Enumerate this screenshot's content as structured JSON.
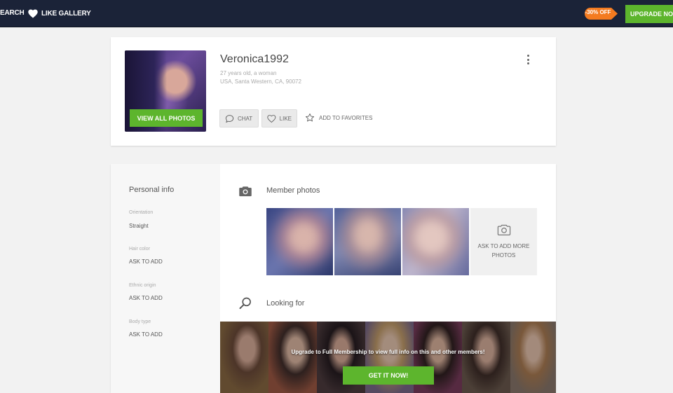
{
  "topbar": {
    "search_label": "EARCH",
    "like_gallery_label": "LIKE GALLERY",
    "discount_label": "-30% OFF",
    "upgrade_label": "UPGRADE NOW",
    "discount_color": "#f47b20",
    "accent_color": "#5db52d"
  },
  "profile": {
    "username": "Veronica1992",
    "age_gender": "27 years old, a woman",
    "location": "USA, Santa Western, CA, 90072",
    "view_photos_label": "VIEW ALL PHOTOS",
    "chat_label": "CHAT",
    "like_label": "LIKE",
    "favorites_label": "ADD TO FAVORITES",
    "menu_icon": "kebab-menu-icon"
  },
  "personal_info": {
    "title": "Personal info",
    "fields": [
      {
        "label": "Orientation",
        "value": "Straight"
      },
      {
        "label": "Hair color",
        "value": "ASK TO ADD"
      },
      {
        "label": "Ethnic origin",
        "value": "ASK TO ADD"
      },
      {
        "label": "Body type",
        "value": "ASK TO ADD"
      }
    ]
  },
  "member_photos": {
    "title": "Member photos",
    "add_more_label": "ASK TO ADD MORE PHOTOS"
  },
  "looking_for": {
    "title": "Looking for",
    "banner_text": "Upgrade to Full Membership to view full info on this and other members!",
    "cta_label": "GET IT NOW!"
  }
}
